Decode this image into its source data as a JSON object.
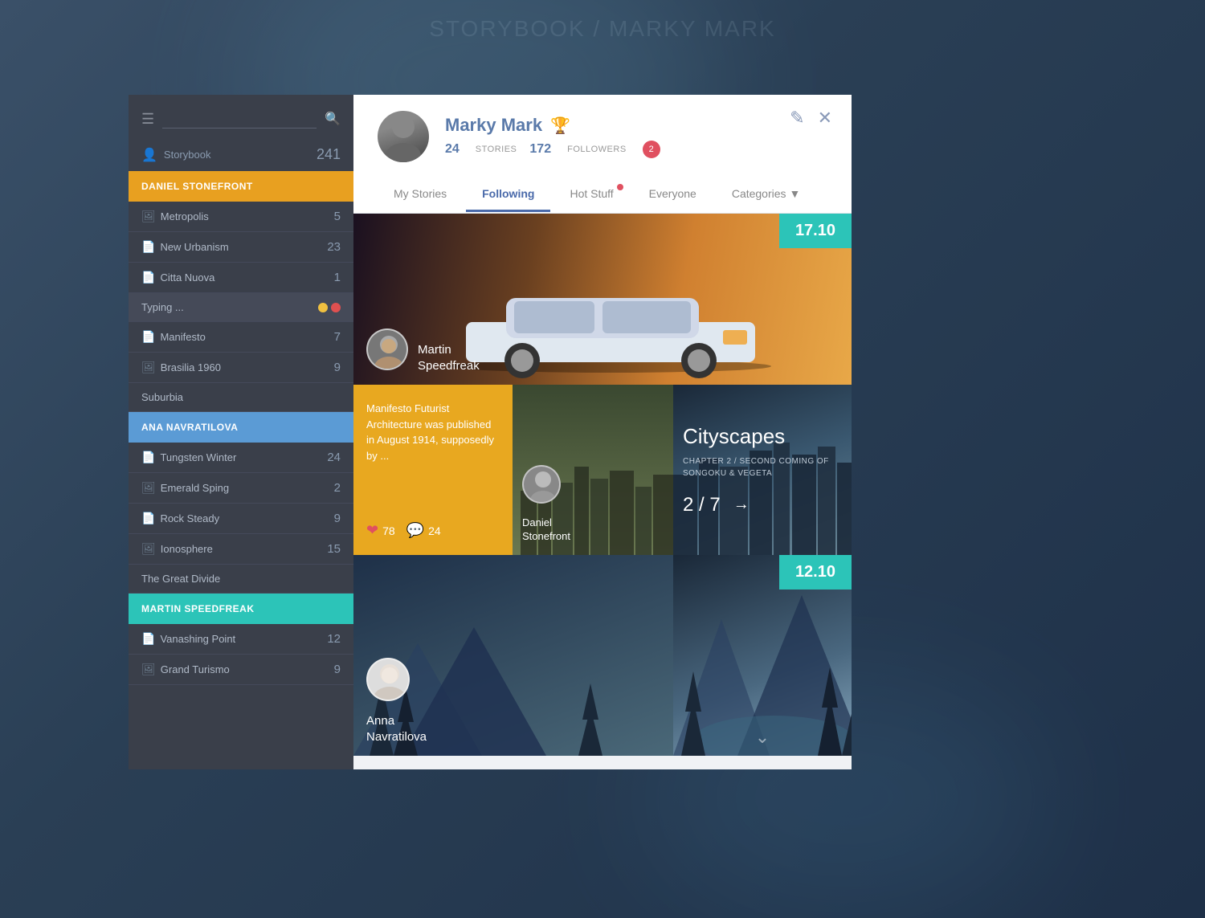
{
  "background": {
    "topText": "STORYBOOK / MARKY MARK"
  },
  "sidebar": {
    "searchPlaceholder": "",
    "storybookLabel": "Storybook",
    "storybookCount": "241",
    "sections": [
      {
        "id": "daniel",
        "label": "DANIEL STONEFRONT",
        "colorClass": "daniel",
        "items": [
          {
            "name": "Metropolis",
            "icon": "image",
            "count": "5"
          },
          {
            "name": "New Urbanism",
            "icon": "doc",
            "count": "23"
          },
          {
            "name": "Citta Nuova",
            "icon": "doc",
            "count": "1"
          },
          {
            "name": "Typing ...",
            "icon": "typing",
            "count": ""
          },
          {
            "name": "Manifesto",
            "icon": "doc",
            "count": "7"
          },
          {
            "name": "Brasilia 1960",
            "icon": "image",
            "count": "9"
          },
          {
            "name": "Suburbia",
            "icon": "",
            "count": ""
          }
        ]
      },
      {
        "id": "ana",
        "label": "ANA NAVRATILOVA",
        "colorClass": "ana",
        "items": [
          {
            "name": "Tungsten Winter",
            "icon": "doc",
            "count": "24"
          },
          {
            "name": "Emerald Sping",
            "icon": "image",
            "count": "2"
          },
          {
            "name": "Rock Steady",
            "icon": "doc",
            "count": "9"
          },
          {
            "name": "Ionosphere",
            "icon": "image",
            "count": "15"
          },
          {
            "name": "The Great Divide",
            "icon": "",
            "count": ""
          }
        ]
      },
      {
        "id": "martin",
        "label": "MARTIN SPEEDFREAK",
        "colorClass": "martin",
        "items": [
          {
            "name": "Vanashing Point",
            "icon": "doc",
            "count": "12"
          },
          {
            "name": "Grand Turismo",
            "icon": "image",
            "count": "9"
          }
        ]
      }
    ]
  },
  "profile": {
    "name": "Marky Mark",
    "storiesCount": "24",
    "storiesLabel": "STORIES",
    "followersCount": "172",
    "followersLabel": "FOLLOWERS",
    "msgCount": "2",
    "editLabel": "✎",
    "closeLabel": "✕"
  },
  "tabs": [
    {
      "id": "my-stories",
      "label": "My Stories",
      "active": false
    },
    {
      "id": "following",
      "label": "Following",
      "active": true
    },
    {
      "id": "hot-stuff",
      "label": "Hot Stuff",
      "active": false,
      "hasDot": true
    },
    {
      "id": "everyone",
      "label": "Everyone",
      "active": false
    },
    {
      "id": "categories",
      "label": "Categories",
      "active": false,
      "hasArrow": true
    }
  ],
  "cards": {
    "card1": {
      "authorName": "Martin\nSpeedfreak",
      "dateBadge": "17.10"
    },
    "card2": {
      "yellowText": "Manifesto Futurist Architecture was published in August 1914, supposedly by ...",
      "likes": "78",
      "comments": "24",
      "cityAuthor": "Daniel\nStonefront",
      "cityscapesTitle": "Cityscapes",
      "cityscapesSub": "CHAPTER 2 / SECOND COMING\nOF SONGOKU & VEGETA",
      "cityscapesProgress": "2 / 7"
    },
    "card3": {
      "winterAuthor": "Anna\nNavratilova",
      "dateBadge": "12.10"
    }
  }
}
